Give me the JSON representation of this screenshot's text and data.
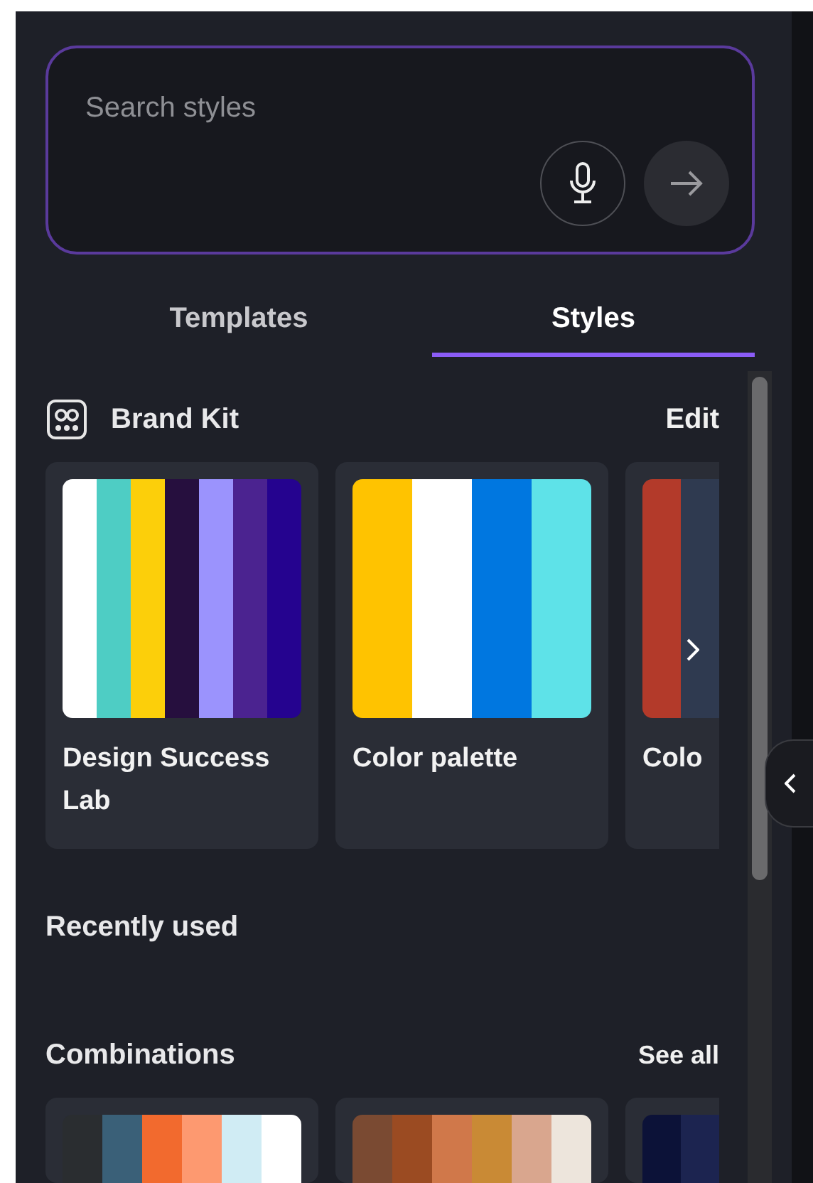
{
  "search": {
    "placeholder": "Search styles"
  },
  "tabs": [
    {
      "label": "Templates",
      "selected": false
    },
    {
      "label": "Styles",
      "selected": true
    }
  ],
  "brand_kit": {
    "title": "Brand Kit",
    "action": "Edit",
    "cards": [
      {
        "title": "Design Success Lab",
        "swatches": [
          {
            "color": "#ffffff"
          },
          {
            "color": "#4ecdc4"
          },
          {
            "color": "#fccf0a"
          },
          {
            "color": "#260f3e"
          },
          {
            "color": "#9b93fd"
          },
          {
            "color": "#4b2390"
          },
          {
            "color": "#25038f"
          }
        ]
      },
      {
        "title": "Color palette",
        "swatches": [
          {
            "color": "#ffc300"
          },
          {
            "color": "#ffffff"
          },
          {
            "color": "#0077e0"
          },
          {
            "color": "#5ee2e8"
          }
        ]
      },
      {
        "title": "Colo",
        "swatches": [
          {
            "color": "#b33a2a"
          },
          {
            "color": "#2f3a50"
          }
        ]
      }
    ]
  },
  "recently_used": {
    "title": "Recently used"
  },
  "combinations": {
    "title": "Combinations",
    "action": "See all",
    "cards": [
      {
        "swatches": [
          {
            "color": "#2a2d30"
          },
          {
            "color": "#3a6078"
          },
          {
            "color": "#f26a2e"
          },
          {
            "color": "#fd9970"
          },
          {
            "color": "#d0ecf4"
          },
          {
            "color": "#ffffff"
          }
        ]
      },
      {
        "swatches": [
          {
            "color": "#7a4a32"
          },
          {
            "color": "#9b4b22"
          },
          {
            "color": "#d0784a"
          },
          {
            "color": "#c98a35"
          },
          {
            "color": "#d9a68e"
          },
          {
            "color": "#ede5dc"
          }
        ]
      },
      {
        "swatches": [
          {
            "color": "#0c1238"
          },
          {
            "color": "#1c2450"
          }
        ]
      }
    ]
  }
}
